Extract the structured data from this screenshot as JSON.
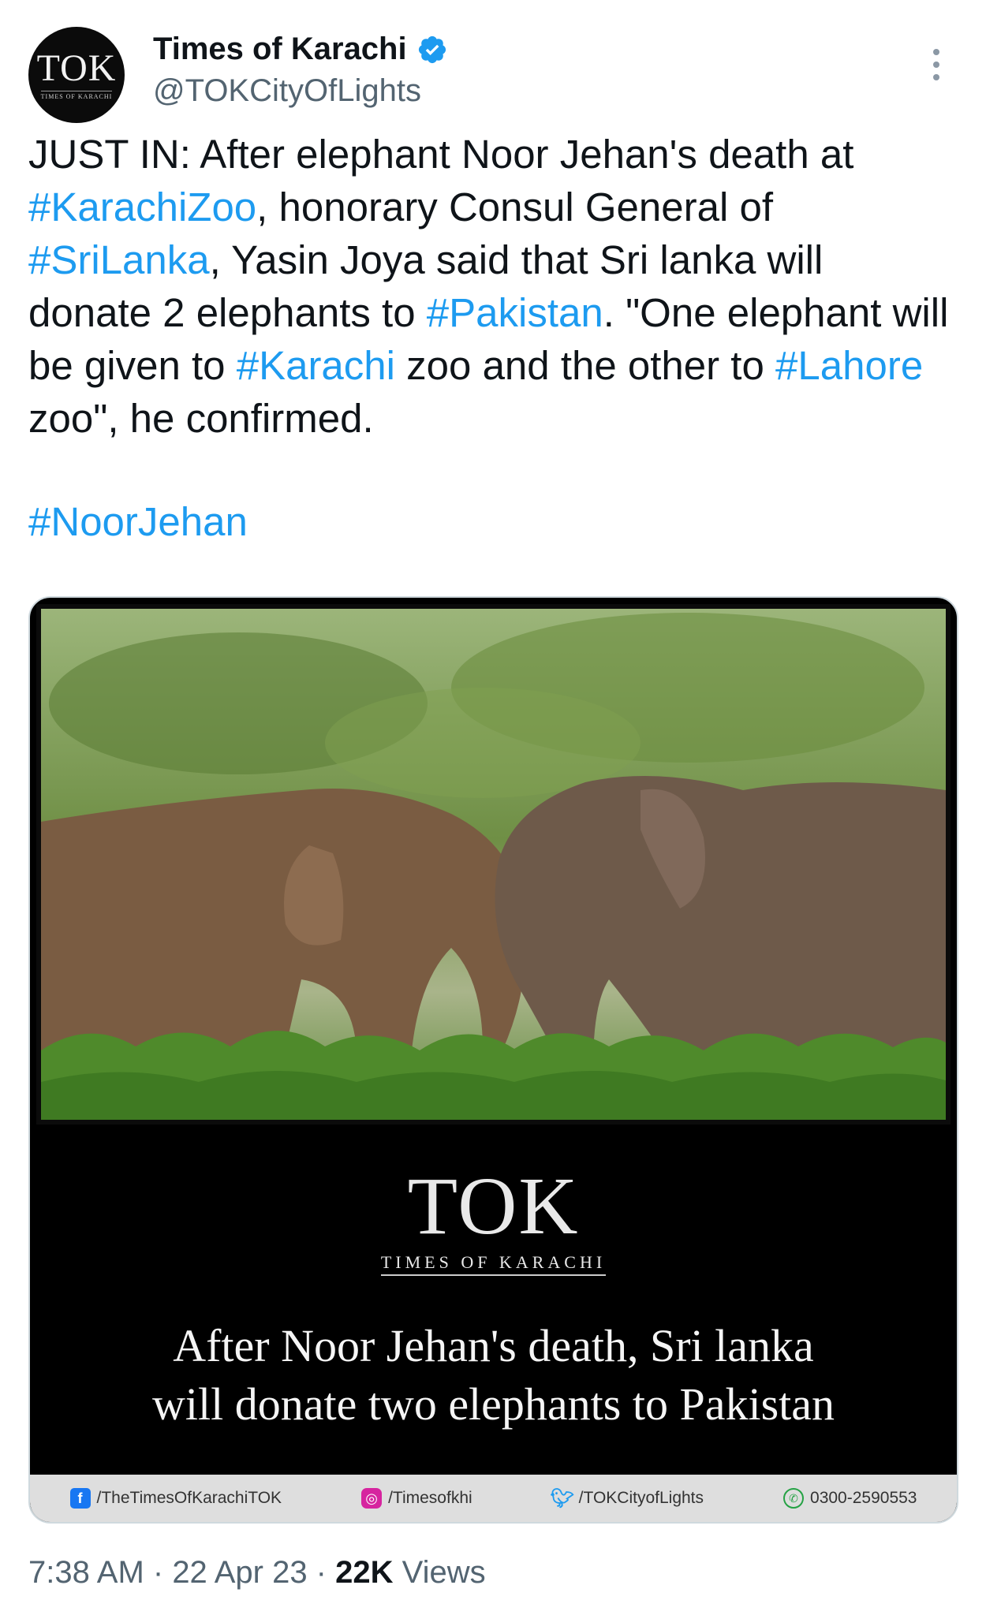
{
  "author": {
    "display_name": "Times of Karachi",
    "handle": "@TOKCityOfLights",
    "avatar_logo": "TOK",
    "avatar_sub": "TIMES OF KARACHI",
    "verified_icon": "verified-badge-icon"
  },
  "tweet": {
    "p1": "JUST IN: After elephant Noor Jehan's death at ",
    "tag1": "#KarachiZoo",
    "p2": ", honorary Consul General of ",
    "tag2": "#SriLanka",
    "p3": ", Yasin Joya said that Sri lanka will donate 2 elephants to ",
    "tag3": "#Pakistan",
    "p4": ". \"One elephant will be given to ",
    "tag4": "#Karachi",
    "p5": " zoo and the other to ",
    "tag5": "#Lahore",
    "p6": " zoo\", he confirmed.",
    "tag6": "#NoorJehan"
  },
  "media": {
    "brand_logo": "TOK",
    "brand_sub": "TIMES OF KARACHI",
    "headline_line1": "After Noor Jehan's death, Sri lanka",
    "headline_line2": "will donate two elephants to Pakistan",
    "footer": {
      "facebook": "/TheTimesOfKarachiTOK",
      "instagram": "/Timesofkhi",
      "twitter": "/TOKCityofLights",
      "whatsapp": "0300-2590553"
    }
  },
  "meta": {
    "time": "7:38 AM",
    "sep1": " · ",
    "date": "22 Apr 23",
    "sep2": " · ",
    "views_count": "22K",
    "views_label": " Views"
  },
  "colors": {
    "link": "#1d9bf0",
    "secondary_text": "#536471"
  }
}
